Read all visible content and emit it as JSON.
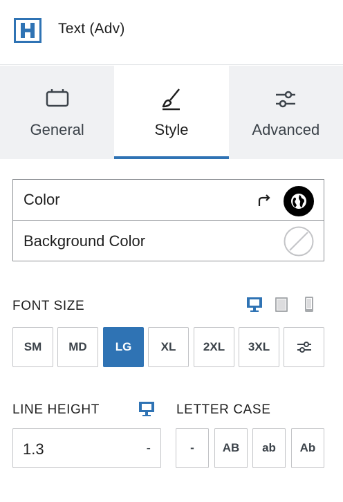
{
  "header": {
    "block_icon": "heading-h-icon",
    "title": "Text (Adv)"
  },
  "tabs": [
    {
      "label": "General",
      "icon": "box-icon",
      "active": false
    },
    {
      "label": "Style",
      "icon": "paintbrush-icon",
      "active": true
    },
    {
      "label": "Advanced",
      "icon": "sliders-icon",
      "active": false
    }
  ],
  "colors": {
    "color_label": "Color",
    "background_label": "Background Color"
  },
  "font_size": {
    "label": "FONT SIZE",
    "options": [
      "SM",
      "MD",
      "LG",
      "XL",
      "2XL",
      "3XL"
    ],
    "selected": "LG"
  },
  "line_height": {
    "label": "LINE HEIGHT",
    "value": "1.3",
    "unit": "-"
  },
  "letter_case": {
    "label": "LETTER CASE",
    "options": [
      "-",
      "AB",
      "ab",
      "Ab"
    ]
  },
  "accent_color": "#2f73b4"
}
